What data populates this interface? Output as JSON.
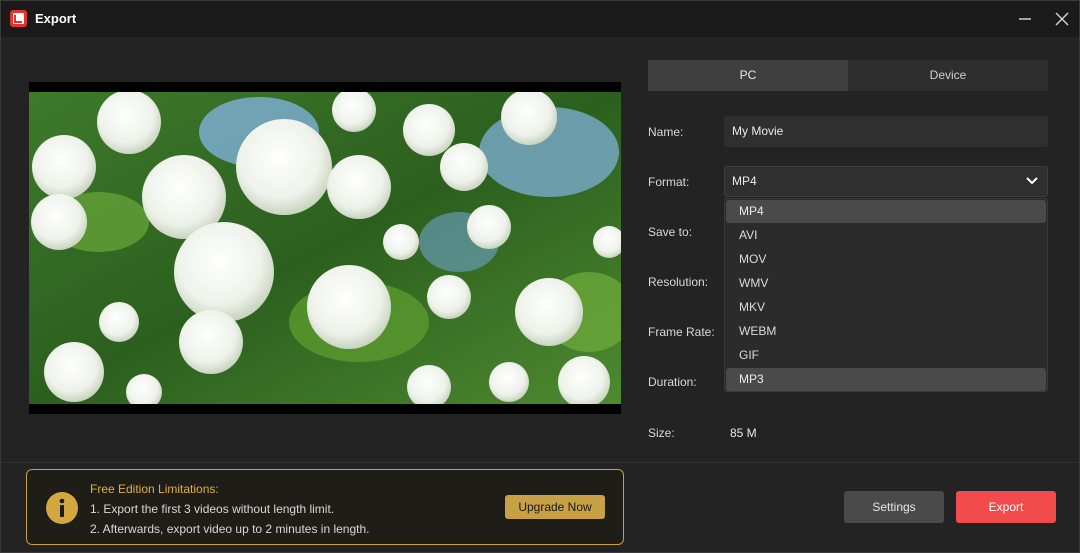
{
  "window": {
    "title": "Export"
  },
  "tabs": [
    {
      "label": "PC",
      "active": true
    },
    {
      "label": "Device",
      "active": false
    }
  ],
  "fields": {
    "name_label": "Name:",
    "name_value": "My Movie",
    "format_label": "Format:",
    "format_value": "MP4",
    "save_to_label": "Save to:",
    "resolution_label": "Resolution:",
    "frame_rate_label": "Frame Rate:",
    "duration_label": "Duration:",
    "size_label": "Size:",
    "size_value": "85 M"
  },
  "format_options": [
    "MP4",
    "AVI",
    "MOV",
    "WMV",
    "MKV",
    "WEBM",
    "GIF",
    "MP3"
  ],
  "format_highlighted": [
    "MP4",
    "MP3"
  ],
  "notice": {
    "title": "Free Edition Limitations:",
    "line1": "1. Export the first 3 videos without length limit.",
    "line2": "2. Afterwards, export video up to 2 minutes in length.",
    "upgrade_label": "Upgrade Now"
  },
  "buttons": {
    "settings": "Settings",
    "export": "Export"
  },
  "colors": {
    "accent": "#f24b4b",
    "warning": "#e0b042",
    "upgrade": "#c8a046"
  },
  "icons": [
    "app-logo-icon",
    "minimize-icon",
    "close-icon",
    "chevron-down-icon",
    "info-icon"
  ]
}
